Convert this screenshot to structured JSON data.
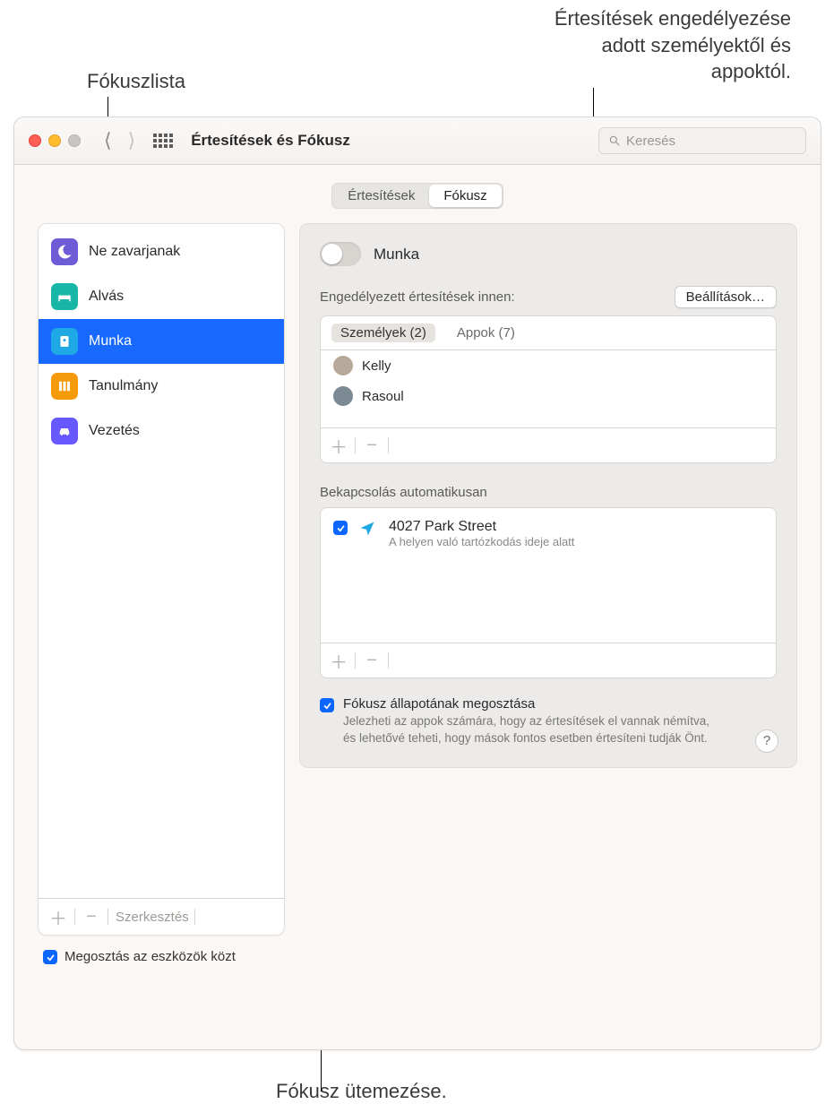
{
  "callouts": {
    "top_left": "Fókuszlista",
    "top_right_l1": "Értesítések engedélyezése",
    "top_right_l2": "adott személyektől és",
    "top_right_l3": "appoktól.",
    "bottom": "Fókusz ütemezése."
  },
  "titlebar": {
    "title": "Értesítések és Fókusz",
    "search_placeholder": "Keresés"
  },
  "tabs": {
    "left": "Értesítések",
    "right": "Fókusz"
  },
  "focus_list": {
    "items": [
      {
        "label": "Ne zavarjanak"
      },
      {
        "label": "Alvás"
      },
      {
        "label": "Munka"
      },
      {
        "label": "Tanulmány"
      },
      {
        "label": "Vezetés"
      }
    ],
    "edit": "Szerkesztés",
    "share_devices": "Megosztás az eszközök közt"
  },
  "detail": {
    "toggle_label": "Munka",
    "allowed_title": "Engedélyezett értesítések innen:",
    "options_btn": "Beállítások…",
    "sub_tabs": {
      "people": "Személyek (2)",
      "apps": "Appok (7)"
    },
    "people": [
      {
        "name": "Kelly"
      },
      {
        "name": "Rasoul"
      }
    ],
    "auto_title": "Bekapcsolás automatikusan",
    "auto_item": {
      "line1": "4027 Park Street",
      "line2": "A helyen való tartózkodás ideje alatt"
    },
    "share_status": {
      "title": "Fókusz állapotának megosztása",
      "desc": "Jelezheti az appok számára, hogy az értesítések el vannak némítva, és lehetővé teheti, hogy mások fontos esetben értesíteni tudják Önt."
    },
    "help": "?"
  }
}
